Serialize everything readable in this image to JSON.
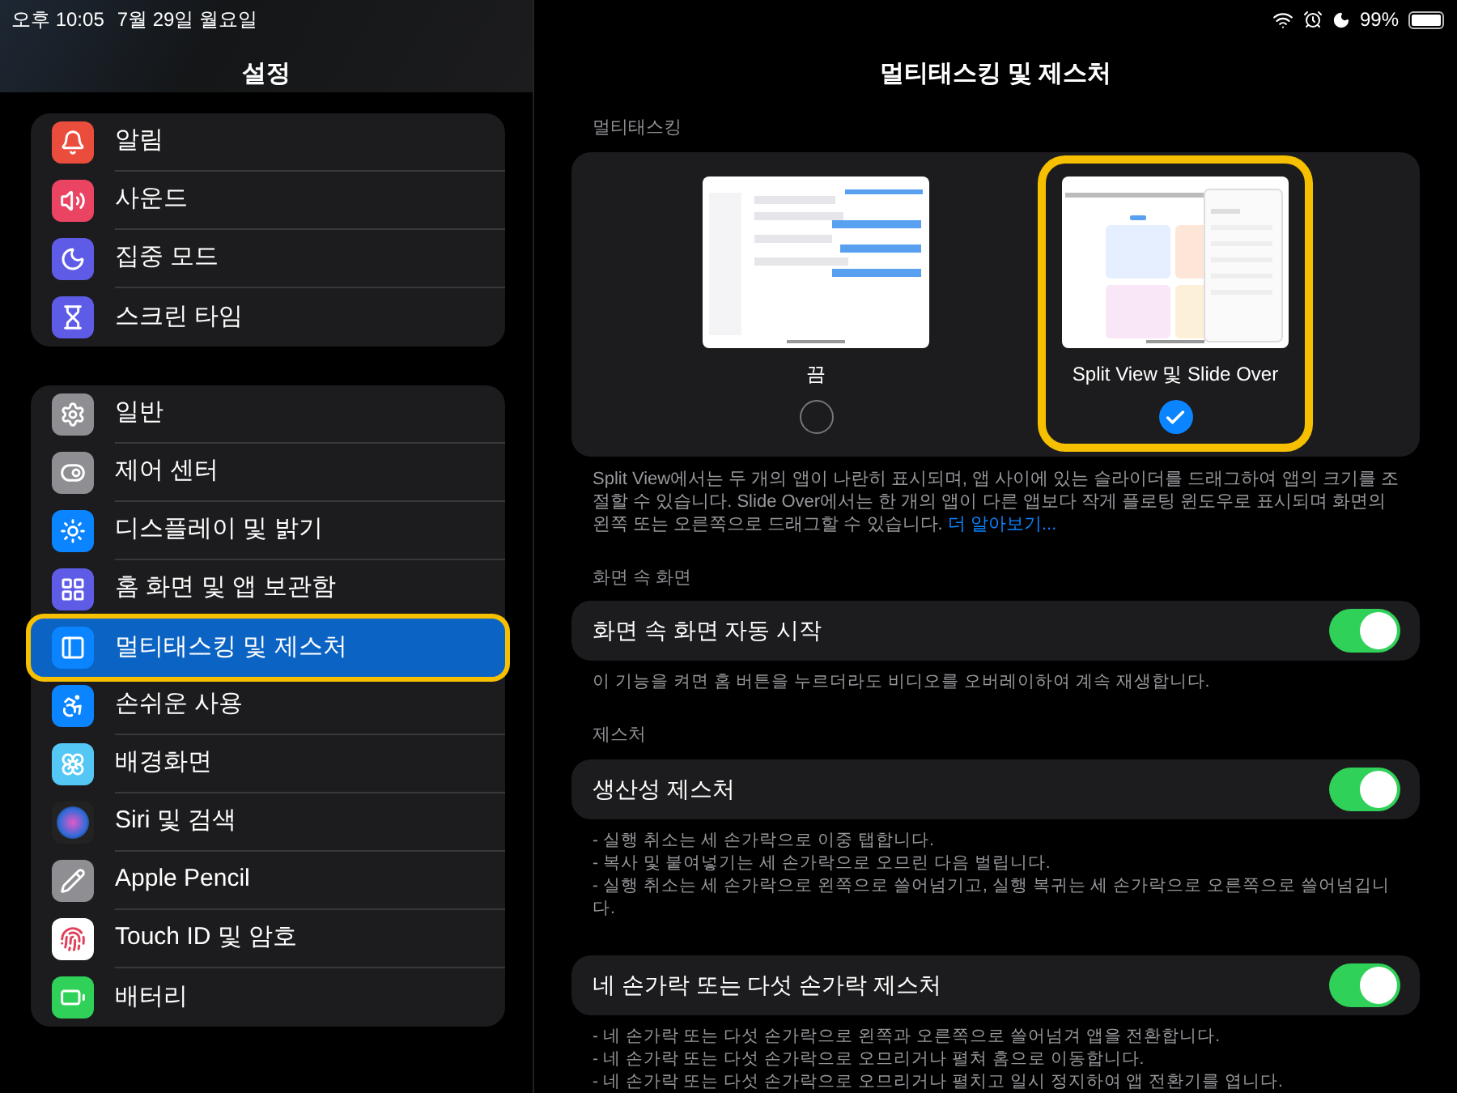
{
  "status_bar": {
    "time": "오후 10:05",
    "date": "7월 29일 월요일",
    "battery": "99%"
  },
  "sidebar": {
    "title": "설정",
    "groups": [
      [
        {
          "label": "알림",
          "selected": false
        },
        {
          "label": "사운드",
          "selected": false
        },
        {
          "label": "집중 모드",
          "selected": false
        },
        {
          "label": "스크린 타임",
          "selected": false
        }
      ],
      [
        {
          "label": "일반",
          "selected": false
        },
        {
          "label": "제어 센터",
          "selected": false
        },
        {
          "label": "디스플레이 및 밝기",
          "selected": false
        },
        {
          "label": "홈 화면 및 앱 보관함",
          "selected": false
        },
        {
          "label": "멀티태스킹 및 제스처",
          "selected": true
        },
        {
          "label": "손쉬운 사용",
          "selected": false
        },
        {
          "label": "배경화면",
          "selected": false
        },
        {
          "label": "Siri 및 검색",
          "selected": false
        },
        {
          "label": "Apple Pencil",
          "selected": false
        },
        {
          "label": "Touch ID 및 암호",
          "selected": false
        },
        {
          "label": "배터리",
          "selected": false
        }
      ]
    ]
  },
  "detail": {
    "title": "멀티태스킹 및 제스처",
    "multitasking": {
      "header": "멀티태스킹",
      "options": [
        {
          "kind": "off",
          "label": "끔",
          "selected": false
        },
        {
          "kind": "split",
          "label": "Split View 및 Slide Over",
          "selected": true
        }
      ],
      "footer": "Split View에서는 두 개의 앱이 나란히 표시되며, 앱 사이에 있는 슬라이더를 드래그하여 앱의 크기를 조절할 수 있습니다. Slide Over에서는 한 개의 앱이 다른 앱보다 작게 플로팅 윈도우로 표시되며 화면의 왼쪽 또는 오른쪽으로 드래그할 수 있습니다.",
      "link": "더 알아보기..."
    },
    "sections": [
      {
        "header": "화면 속 화면",
        "label": "화면 속 화면 자동 시작",
        "on": true,
        "footer": [
          "이 기능을 켜면 홈 버튼을 누르더라도 비디오를 오버레이하여 계속 재생합니다."
        ]
      },
      {
        "header": "제스처",
        "label": "생산성 제스처",
        "on": true,
        "footer": [
          "- 실행 취소는 세 손가락으로 이중 탭합니다.",
          "- 복사 및 붙여넣기는 세 손가락으로 오므린 다음 벌립니다.",
          "- 실행 취소는 세 손가락으로 왼쪽으로 쓸어넘기고, 실행 복귀는 세 손가락으로 오른쪽으로 쓸어넘깁니다."
        ]
      },
      {
        "label": "네 손가락 또는 다섯 손가락 제스처",
        "on": true,
        "footer": [
          "- 네 손가락 또는 다섯 손가락으로 왼쪽과 오른쪽으로 쓸어넘겨 앱을 전환합니다.",
          "- 네 손가락 또는 다섯 손가락으로 오므리거나 펼쳐 홈으로 이동합니다.",
          "- 네 손가락 또는 다섯 손가락으로 오므리거나 펼치고 일시 정지하여 앱 전환기를 엽니다."
        ]
      }
    ]
  }
}
